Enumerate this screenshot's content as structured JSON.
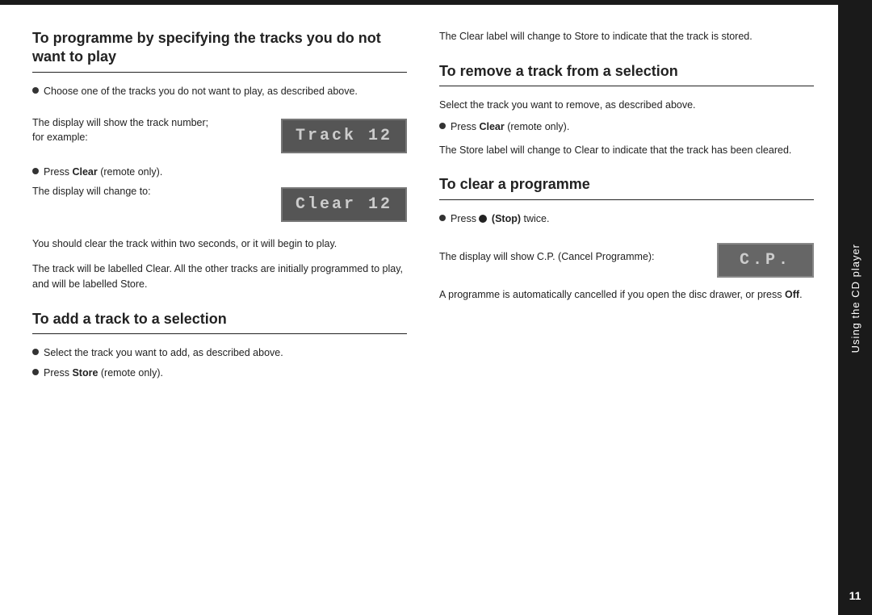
{
  "page": {
    "top_rule": true,
    "page_number": "11",
    "sidebar_label": "Using the CD player"
  },
  "left_section": {
    "title": "To programme by specifying the tracks you do not want to play",
    "bullet1": "Choose one of the tracks you do not want to play, as described above.",
    "display_label1": "The display will show the track number; for example:",
    "display_track": "Track 12",
    "bullet2_prefix": "Press ",
    "bullet2_bold": "Clear",
    "bullet2_suffix": " (remote only).",
    "display_label2": "The display will change to:",
    "display_clear": "Clear 12",
    "body1": "You should clear the track within two seconds, or it will begin to play.",
    "body2": "The track will be labelled Clear. All the other tracks are initially programmed to play, and will be labelled Store.",
    "subtitle2": "To add a track to a selection",
    "add_bullet1_prefix": "Select the track you want to add, as described above.",
    "add_bullet2_prefix": "Press ",
    "add_bullet2_bold": "Store",
    "add_bullet2_suffix": " (remote only)."
  },
  "right_section": {
    "intro_text": "The Clear label will change to Store to indicate that the track is stored.",
    "title2": "To remove a track from a selection",
    "remove_body": "Select the track you want to remove, as described above.",
    "remove_bullet_prefix": "Press ",
    "remove_bullet_bold": "Clear",
    "remove_bullet_suffix": " (remote only).",
    "remove_body2": "The Store label will change to Clear to indicate that the track has been cleared.",
    "title3": "To clear a programme",
    "clear_bullet_prefix": "Press ",
    "clear_bullet_icon": "●",
    "clear_bullet_bold": "(Stop)",
    "clear_bullet_suffix": " twice.",
    "cp_label1": "The display will show C.P. (Cancel Programme):",
    "cp_display": "C.P.",
    "cp_body": "A programme is automatically cancelled if you open the disc drawer, or press ",
    "cp_body_bold": "Off",
    "cp_body_end": "."
  }
}
